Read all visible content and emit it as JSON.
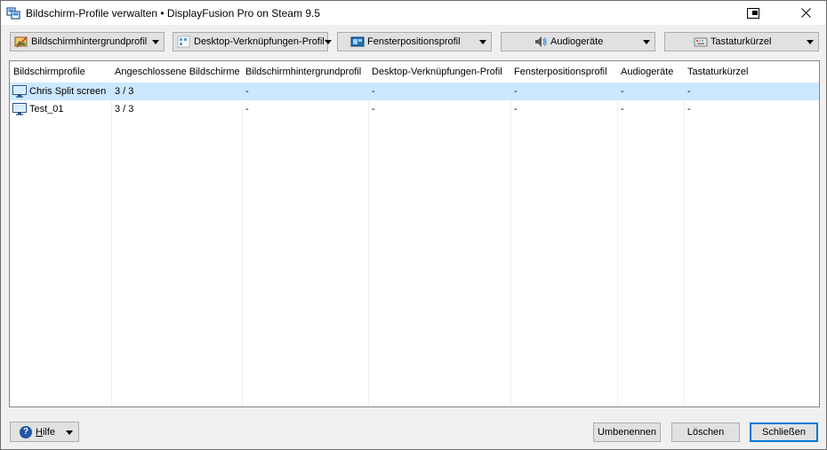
{
  "window": {
    "title": "Bildschirm-Profile verwalten • DisplayFusion Pro on Steam 9.5"
  },
  "toolbar": {
    "wallpaper_label": "Bildschirmhintergrundprofil",
    "desktop_icons_label": "Desktop-Verknüpfungen-Profil",
    "window_position_label": "Fensterpositionsprofil",
    "audio_label": "Audiogeräte",
    "hotkeys_label": "Tastaturkürzel"
  },
  "list": {
    "columns": [
      "Bildschirmprofile",
      "Angeschlossene Bildschirme",
      "Bildschirmhintergrundprofil",
      "Desktop-Verknüpfungen-Profil",
      "Fensterpositionsprofil",
      "Audiogeräte",
      "Tastaturkürzel"
    ],
    "rows": [
      {
        "cells": [
          "Chris Split screen",
          "3 / 3",
          "-",
          "-",
          "-",
          "-",
          "-"
        ],
        "selected": true
      },
      {
        "cells": [
          "Test_01",
          "3 / 3",
          "-",
          "-",
          "-",
          "-",
          "-"
        ],
        "selected": false
      }
    ]
  },
  "bottom": {
    "help_first": "H",
    "help_rest": "ilfe",
    "rename_label": "Umbenennen",
    "delete_label": "Löschen",
    "close_label": "Schließen"
  },
  "icons": {
    "app": "displayfusion-icon",
    "restore": "restore-icon",
    "close": "close-icon",
    "wallpaper": "wallpaper-icon",
    "desktop_icons": "desktop-grid-icon",
    "window_position": "window-position-icon",
    "audio": "speaker-icon",
    "hotkeys": "keyboard-icon",
    "monitor": "monitor-icon",
    "help": "help-icon",
    "dropdown": "chevron-down-icon"
  },
  "colors": {
    "selection": "#cce8ff",
    "default_button_border": "#0078d7"
  }
}
